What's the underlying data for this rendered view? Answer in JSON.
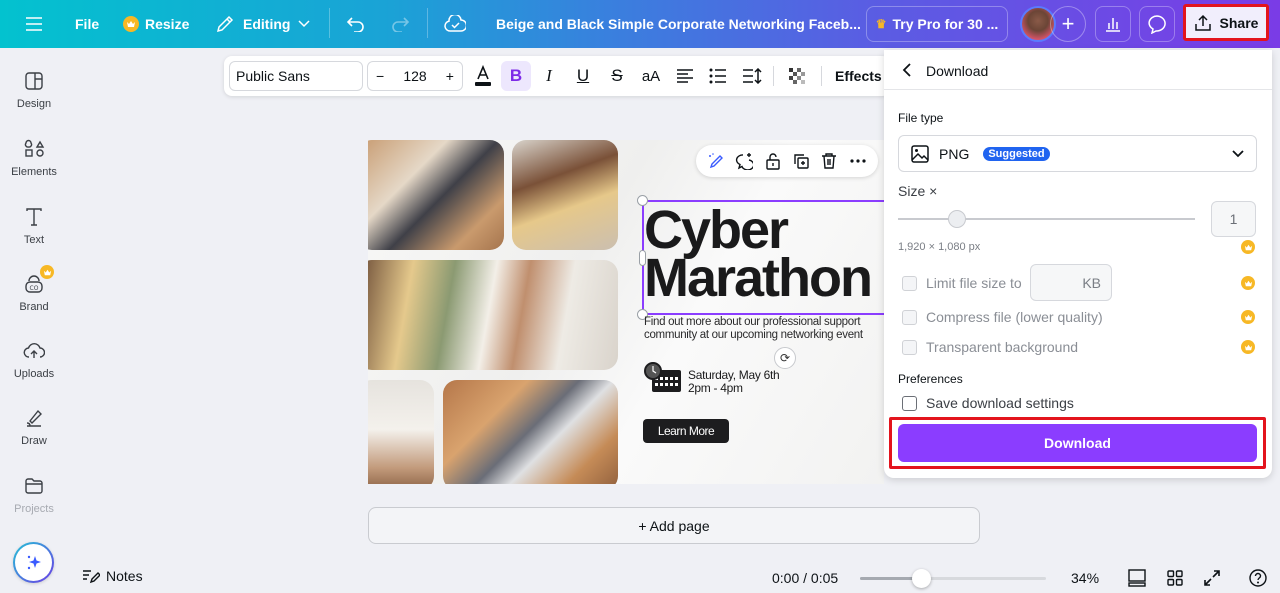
{
  "topbar": {
    "menu_icon": "hamburger-icon",
    "file_label": "File",
    "resize_label": "Resize",
    "editing_label": "Editing",
    "design_title": "Beige and Black Simple Corporate Networking Faceb...",
    "try_pro_label": "Try Pro for 30 ...",
    "share_label": "Share"
  },
  "sidebar": {
    "items": [
      {
        "label": "Design",
        "icon": "layout-icon"
      },
      {
        "label": "Elements",
        "icon": "shapes-icon"
      },
      {
        "label": "Text",
        "icon": "text-icon"
      },
      {
        "label": "Brand",
        "icon": "brand-icon"
      },
      {
        "label": "Uploads",
        "icon": "cloud-upload-icon"
      },
      {
        "label": "Draw",
        "icon": "draw-icon"
      },
      {
        "label": "Projects",
        "icon": "folder-icon"
      }
    ]
  },
  "text_toolbar": {
    "font": "Public Sans",
    "font_size": "128",
    "decrease": "−",
    "increase": "+",
    "effects_label": "Effects"
  },
  "canvas": {
    "headline_line1": "Cyber",
    "headline_line2": "Marathon",
    "subtitle_line1": "Find out more about our professional support",
    "subtitle_line2": "community at our upcoming networking event",
    "event_date": "Saturday, May 6th",
    "event_time": "2pm - 4pm",
    "cta_label": "Learn More"
  },
  "add_page_label": "+ Add page",
  "bottombar": {
    "notes_label": "Notes",
    "timecode": "0:00 / 0:05",
    "timeline_progress": 0.0,
    "zoom_level": "34%",
    "zoom_slider_fraction": 0.33
  },
  "download_panel": {
    "title": "Download",
    "file_type_label": "File type",
    "file_type_value": "PNG",
    "file_type_badge": "Suggested",
    "size_label": "Size ×",
    "size_value": "1",
    "size_slider_fraction": 0.2,
    "dimensions": "1,920 × 1,080 px",
    "limit_file_size_label": "Limit file size to",
    "kb_unit": "KB",
    "compress_label": "Compress file (lower quality)",
    "transparent_label": "Transparent background",
    "preferences_label": "Preferences",
    "save_settings_label": "Save download settings",
    "download_button_label": "Download"
  },
  "colors": {
    "accent_purple": "#8b3dff",
    "highlight_red": "#e3141d",
    "pro_gold": "#f7b825",
    "badge_blue": "#2064f0"
  }
}
